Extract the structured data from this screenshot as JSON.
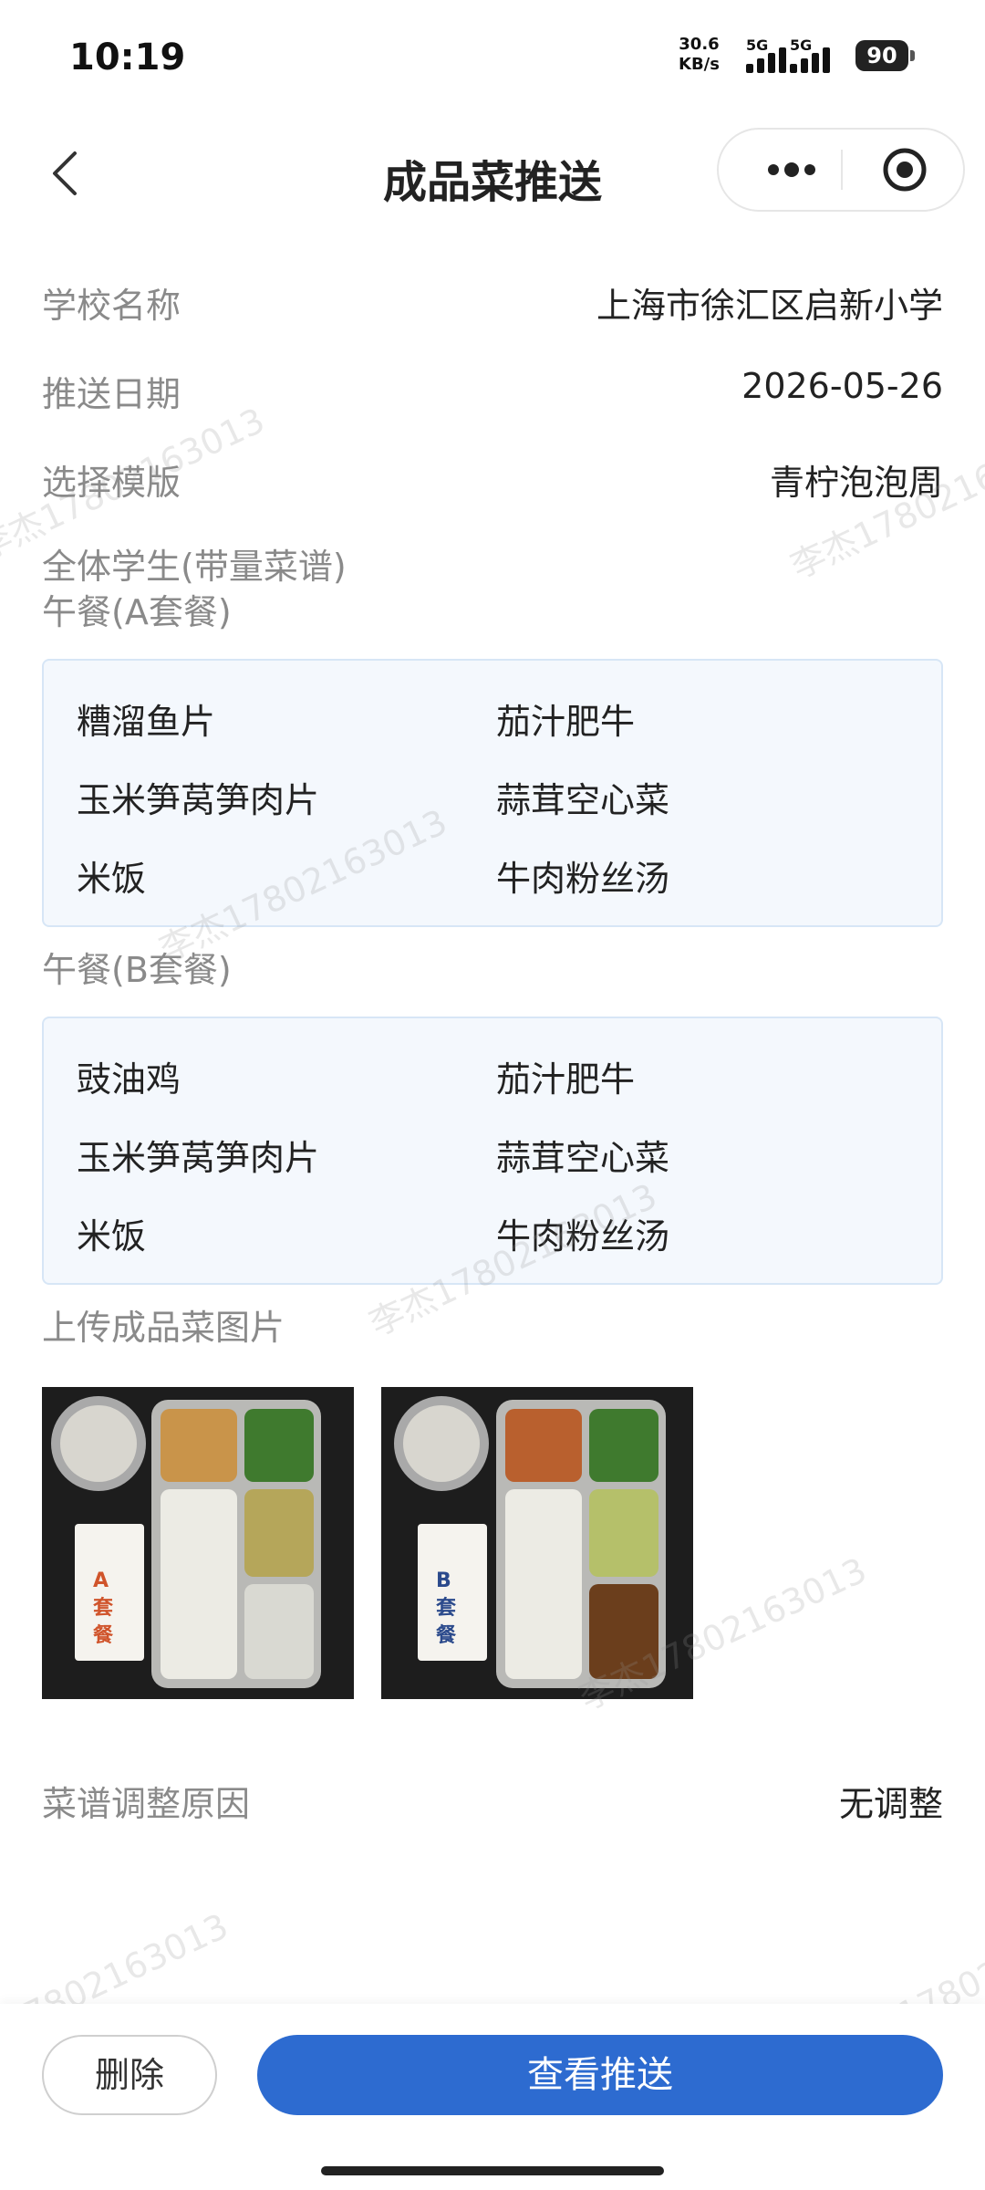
{
  "status_bar": {
    "time": "10:19",
    "speed_value": "30.6",
    "speed_unit": "KB/s",
    "net1": "5G",
    "net2": "5G",
    "battery": "90"
  },
  "nav": {
    "title": "成品菜推送"
  },
  "form": {
    "school_label": "学校名称",
    "school_value": "上海市徐汇区启新小学",
    "date_label": "推送日期",
    "date_value": "2026-05-26",
    "template_label": "选择模版",
    "template_value": "青柠泡泡周",
    "audience_label": "全体学生(带量菜谱)"
  },
  "meals": [
    {
      "label": "午餐(A套餐)",
      "dishes": [
        "糟溜鱼片",
        "茄汁肥牛",
        "玉米笋莴笋肉片",
        "蒜茸空心菜",
        "米饭",
        "牛肉粉丝汤"
      ]
    },
    {
      "label": "午餐(B套餐)",
      "dishes": [
        "豉油鸡",
        "茄汁肥牛",
        "玉米笋莴笋肉片",
        "蒜茸空心菜",
        "米饭",
        "牛肉粉丝汤"
      ]
    }
  ],
  "photos": {
    "label": "上传成品菜图片",
    "items": [
      {
        "card_text": "A套餐"
      },
      {
        "card_text": "B套餐"
      }
    ]
  },
  "adjust": {
    "label": "菜谱调整原因",
    "value": "无调整"
  },
  "watermark": "李杰17802163013",
  "actions": {
    "delete_label": "删除",
    "view_label": "查看推送"
  },
  "colors": {
    "primary": "#2d6bd0",
    "menu_bg": "#f4f8fd",
    "menu_border": "#d7e6f6",
    "label_gray": "#8a8a8a"
  }
}
